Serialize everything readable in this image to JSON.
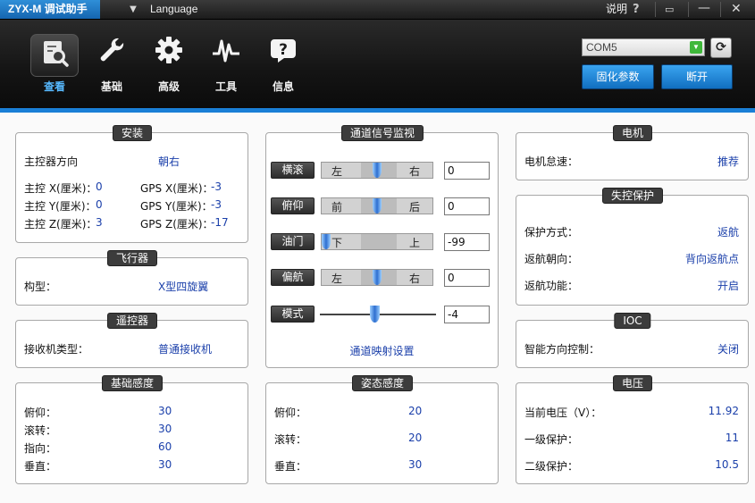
{
  "app": {
    "title": "ZYX-M 调试助手",
    "language_label": "Language",
    "help_label": "说明",
    "help_icon": "question-icon"
  },
  "toolbar": {
    "tools": [
      {
        "label": "查看",
        "icon": "view-search-icon",
        "active": true
      },
      {
        "label": "基础",
        "icon": "wrench-icon"
      },
      {
        "label": "高级",
        "icon": "gear-icon"
      },
      {
        "label": "工具",
        "icon": "pulse-icon"
      },
      {
        "label": "信息",
        "icon": "info-icon"
      }
    ],
    "com_port": "COM5",
    "params_button": "固化参数",
    "disconnect_button": "断开"
  },
  "install": {
    "title": "安装",
    "orientation_label": "主控器方向",
    "orientation_value": "朝右",
    "rows": [
      {
        "label": "主控 X(厘米)：",
        "value": "0",
        "gps_label": "GPS X(厘米)：",
        "gps_value": "-3"
      },
      {
        "label": "主控 Y(厘米)：",
        "value": "0",
        "gps_label": "GPS Y(厘米)：",
        "gps_value": "-3"
      },
      {
        "label": "主控 Z(厘米)：",
        "value": "3",
        "gps_label": "GPS Z(厘米)：",
        "gps_value": "-17"
      }
    ]
  },
  "aircraft": {
    "title": "飞行器",
    "type_label": "构型：",
    "type_value": "X型四旋翼"
  },
  "remote": {
    "title": "遥控器",
    "receiver_label": "接收机类型：",
    "receiver_value": "普通接收机"
  },
  "base_gain": {
    "title": "基础感度",
    "rows": [
      {
        "label": "俯仰：",
        "value": "30"
      },
      {
        "label": "滚转：",
        "value": "30"
      },
      {
        "label": "指向：",
        "value": "60"
      },
      {
        "label": "垂直：",
        "value": "30"
      }
    ]
  },
  "channels": {
    "title": "通道信号监视",
    "mapping_link": "通道映射设置",
    "items": [
      {
        "name": "横滚",
        "left": "左",
        "right": "右",
        "value": "0",
        "position": 0.5
      },
      {
        "name": "俯仰",
        "left": "前",
        "right": "后",
        "value": "0",
        "position": 0.5
      },
      {
        "name": "油门",
        "left": "下",
        "right": "上",
        "value": "-99",
        "position": 0.0
      },
      {
        "name": "偏航",
        "left": "左",
        "right": "右",
        "value": "0",
        "position": 0.5
      }
    ],
    "mode": {
      "name": "模式",
      "value": "-4",
      "position": 0.47
    }
  },
  "attitude_gain": {
    "title": "姿态感度",
    "rows": [
      {
        "label": "俯仰：",
        "value": "20"
      },
      {
        "label": "滚转：",
        "value": "20"
      },
      {
        "label": "垂直：",
        "value": "30"
      }
    ]
  },
  "motor": {
    "title": "电机",
    "idle_label": "电机怠速：",
    "idle_value": "推荐"
  },
  "failsafe": {
    "title": "失控保护",
    "rows": [
      {
        "label": "保护方式：",
        "value": "返航"
      },
      {
        "label": "返航朝向：",
        "value": "背向返航点"
      },
      {
        "label": "返航功能：",
        "value": "开启"
      }
    ]
  },
  "ioc": {
    "title": "IOC",
    "label": "智能方向控制：",
    "value": "关闭"
  },
  "voltage": {
    "title": "电压",
    "rows": [
      {
        "label": "当前电压（V）：",
        "value": "11.92"
      },
      {
        "label": "一级保护：",
        "value": "11"
      },
      {
        "label": "二级保护：",
        "value": "10.5"
      }
    ]
  },
  "colors": {
    "accent": "#1a7fd6",
    "value_text": "#1a3faa",
    "title_bar": "#1565b0"
  }
}
